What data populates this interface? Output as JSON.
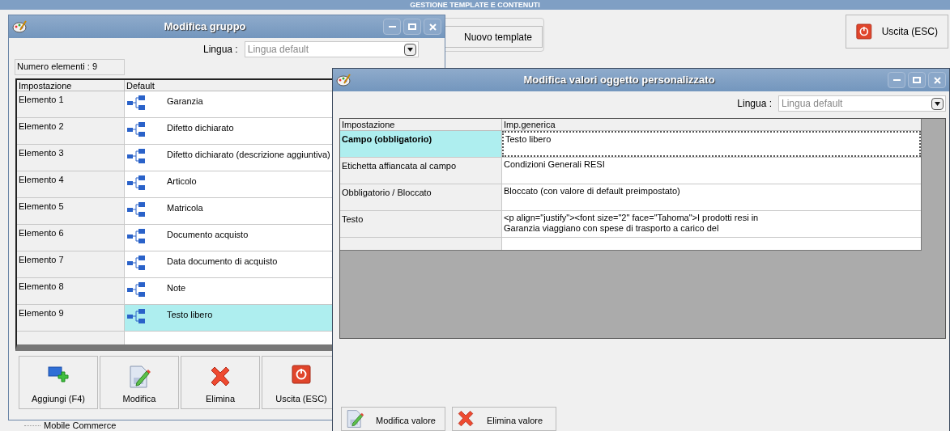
{
  "background_window": {
    "title": "GESTIONE TEMPLATE E CONTENUTI",
    "buttons": [
      {
        "label": "Nuovo template",
        "kind": "new"
      },
      {
        "label": "Uscita (ESC)",
        "kind": "exit"
      }
    ],
    "tree_item": "Mobile Commerce"
  },
  "group_window": {
    "title": "Modifica gruppo",
    "language": {
      "label": "Lingua :",
      "value": "Lingua default"
    },
    "count": "Numero elementi : 9",
    "columns": [
      "Impostazione",
      "Default"
    ],
    "rows": [
      {
        "setting": "Elemento 1",
        "value": "Garanzia",
        "selected": false
      },
      {
        "setting": "Elemento 2",
        "value": "Difetto dichiarato",
        "selected": false
      },
      {
        "setting": "Elemento 3",
        "value": "Difetto dichiarato (descrizione aggiuntiva)",
        "selected": false
      },
      {
        "setting": "Elemento 4",
        "value": "Articolo",
        "selected": false
      },
      {
        "setting": "Elemento 5",
        "value": "Matricola",
        "selected": false
      },
      {
        "setting": "Elemento 6",
        "value": "Documento acquisto",
        "selected": false
      },
      {
        "setting": "Elemento 7",
        "value": "Data documento di acquisto",
        "selected": false
      },
      {
        "setting": "Elemento 8",
        "value": "Note",
        "selected": false
      },
      {
        "setting": "Elemento 9",
        "value": "Testo libero",
        "selected": true
      }
    ],
    "buttons": [
      {
        "label": "Aggiungi (F4)",
        "kind": "add"
      },
      {
        "label": "Modifica",
        "kind": "edit"
      },
      {
        "label": "Elimina",
        "kind": "delete"
      },
      {
        "label": "Uscita (ESC)",
        "kind": "exit"
      }
    ]
  },
  "value_window": {
    "title": "Modifica valori oggetto personalizzato",
    "language": {
      "label": "Lingua :",
      "value": "Lingua default"
    },
    "columns": [
      "Impostazione",
      "Imp.generica"
    ],
    "rows": [
      {
        "setting": "Campo (obbligatorio)",
        "value": "Testo libero",
        "selected": true
      },
      {
        "setting": "Etichetta affiancata al campo",
        "value": "Condizioni Generali RESI",
        "selected": false
      },
      {
        "setting": "Obbligatorio / Bloccato",
        "value": "Bloccato (con valore di default preimpostato)",
        "selected": false
      },
      {
        "setting": "Testo",
        "value": "<p align=\"justify\"><font size=\"2\" face=\"Tahoma\">I prodotti resi in\nGaranzia viaggiano con spese di trasporto a carico del",
        "selected": false
      }
    ],
    "buttons": [
      {
        "label": "Modifica valore",
        "kind": "edit"
      },
      {
        "label": "Elimina valore",
        "kind": "delete"
      }
    ]
  }
}
